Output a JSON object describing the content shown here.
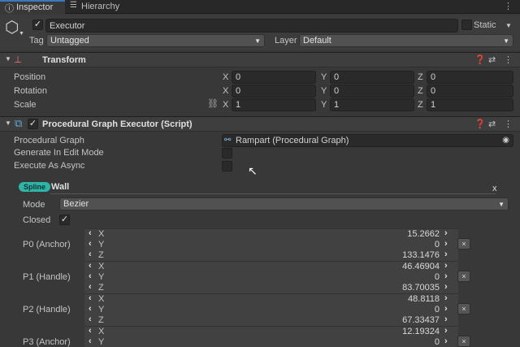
{
  "tabs": [
    {
      "label": "Inspector",
      "icon": "info-icon"
    },
    {
      "label": "Hierarchy",
      "icon": "list-icon"
    }
  ],
  "object": {
    "name": "Executor",
    "static_label": "Static",
    "tag_label": "Tag",
    "tag_value": "Untagged",
    "layer_label": "Layer",
    "layer_value": "Default"
  },
  "transform": {
    "title": "Transform",
    "rows": [
      {
        "label": "Position",
        "x": "0",
        "y": "0",
        "z": "0"
      },
      {
        "label": "Rotation",
        "x": "0",
        "y": "0",
        "z": "0"
      },
      {
        "label": "Scale",
        "x": "1",
        "y": "1",
        "z": "1"
      }
    ],
    "axis_x": "X",
    "axis_y": "Y",
    "axis_z": "Z"
  },
  "executor": {
    "title": "Procedural Graph Executor (Script)",
    "graph_label": "Procedural Graph",
    "graph_value": "Rampart (Procedural Graph)",
    "edit_mode_label": "Generate In Edit Mode",
    "async_label": "Execute As Async"
  },
  "spline": {
    "badge": "Spline",
    "name": "Wall",
    "close": "x",
    "mode_label": "Mode",
    "mode_value": "Bezier",
    "closed_label": "Closed",
    "points": [
      {
        "label": "P0 (Anchor)",
        "x": "15.2662",
        "y": "0",
        "z": "133.1476"
      },
      {
        "label": "P1 (Handle)",
        "x": "46.46904",
        "y": "0",
        "z": "83.70035"
      },
      {
        "label": "P2 (Handle)",
        "x": "48.8118",
        "y": "0",
        "z": "67.33437"
      },
      {
        "label": "P3 (Anchor)",
        "x": "12.19324",
        "y": "0",
        "z": ""
      }
    ],
    "axis_x": "X",
    "axis_y": "Y",
    "axis_z": "Z",
    "remove": "×"
  }
}
